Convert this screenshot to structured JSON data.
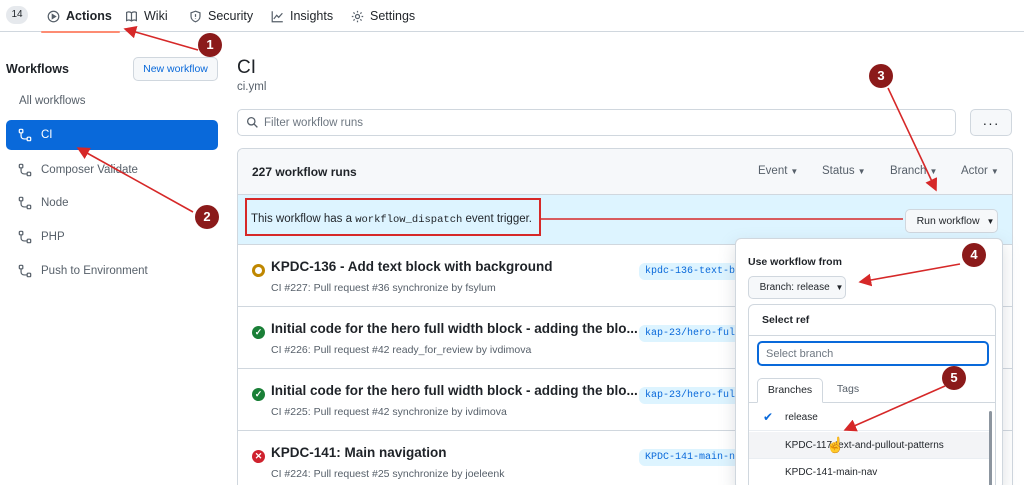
{
  "nav": {
    "counter": "14",
    "tabs": [
      {
        "label": "Actions",
        "icon": "play-icon",
        "active": true
      },
      {
        "label": "Wiki",
        "icon": "book-icon"
      },
      {
        "label": "Security",
        "icon": "shield-icon"
      },
      {
        "label": "Insights",
        "icon": "graph-icon"
      },
      {
        "label": "Settings",
        "icon": "gear-icon"
      }
    ]
  },
  "sidebar": {
    "title": "Workflows",
    "new_workflow": "New workflow",
    "all_workflows": "All workflows",
    "items": [
      {
        "label": "CI",
        "active": true
      },
      {
        "label": "Composer Validate"
      },
      {
        "label": "Node"
      },
      {
        "label": "PHP"
      },
      {
        "label": "Push to Environment"
      }
    ]
  },
  "main": {
    "title": "CI",
    "file": "ci.yml",
    "filter_placeholder": "Filter workflow runs",
    "more_label": "···",
    "runs_count": "227 workflow runs",
    "filters": [
      "Event",
      "Status",
      "Branch",
      "Actor"
    ],
    "dispatch": {
      "prefix": "This workflow has a",
      "code": "workflow_dispatch",
      "suffix": "event trigger.",
      "button": "Run workflow"
    },
    "runs": [
      {
        "title": "KPDC-136 - Add text block with background",
        "meta": "CI #227: Pull request #36 synchronize by fsylum",
        "branch": "kpdc-136-text-bl",
        "status": "in-progress"
      },
      {
        "title": "Initial code for the hero full width block - adding the blo...",
        "meta": "CI #226: Pull request #42 ready_for_review by ivdimova",
        "branch": "kap-23/hero-full",
        "status": "success"
      },
      {
        "title": "Initial code for the hero full width block - adding the blo...",
        "meta": "CI #225: Pull request #42 synchronize by ivdimova",
        "branch": "kap-23/hero-full-w",
        "status": "success"
      },
      {
        "title": "KPDC-141: Main navigation",
        "meta": "CI #224: Pull request #25 synchronize by joeleenk",
        "branch": "KPDC-141-main-nav",
        "status": "failure"
      }
    ]
  },
  "dropdown": {
    "label": "Use workflow from",
    "branch_button": "Branch: release",
    "select_ref": "Select ref",
    "search_placeholder": "Select branch",
    "tabs": [
      "Branches",
      "Tags"
    ],
    "branches": [
      {
        "name": "release",
        "selected": true
      },
      {
        "name": "KPDC-117-text-and-pullout-patterns"
      },
      {
        "name": "KPDC-141-main-nav"
      }
    ]
  },
  "annotations": [
    "1",
    "2",
    "3",
    "4",
    "5"
  ],
  "colors": {
    "accent": "#0969da",
    "annotation": "#8b1a1a",
    "arrow": "#d62828",
    "success": "#1a7f37",
    "pending": "#bf8700",
    "failure": "#cf222e",
    "tab_underline": "#fd8c73"
  }
}
